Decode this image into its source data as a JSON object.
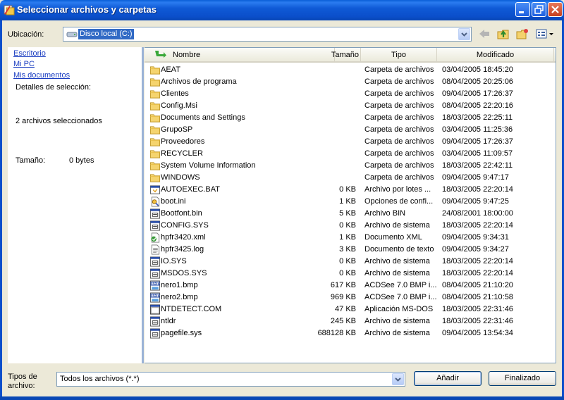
{
  "window": {
    "title": "Seleccionar archivos y carpetas"
  },
  "location": {
    "label": "Ubicación:",
    "value": "Disco local (C:)"
  },
  "left_panel": {
    "links": [
      "Escritorio",
      "Mi PC",
      "Mis documentos"
    ],
    "details_label": "Detalles de selección:",
    "selected_count": "2 archivos seleccionados",
    "size_label": "Tamaño:",
    "size_value": "0 bytes"
  },
  "columns": {
    "name": "Nombre",
    "size": "Tamaño",
    "type": "Tipo",
    "modified": "Modificado"
  },
  "files": [
    {
      "name": "AEAT",
      "size": "",
      "type": "Carpeta de archivos",
      "modified": "03/04/2005 18:45:20",
      "icon": "folder-icon"
    },
    {
      "name": "Archivos de programa",
      "size": "",
      "type": "Carpeta de archivos",
      "modified": "08/04/2005 20:25:06",
      "icon": "folder-icon"
    },
    {
      "name": "Clientes",
      "size": "",
      "type": "Carpeta de archivos",
      "modified": "09/04/2005 17:26:37",
      "icon": "folder-icon"
    },
    {
      "name": "Config.Msi",
      "size": "",
      "type": "Carpeta de archivos",
      "modified": "08/04/2005 22:20:16",
      "icon": "folder-icon"
    },
    {
      "name": "Documents and Settings",
      "size": "",
      "type": "Carpeta de archivos",
      "modified": "18/03/2005 22:25:11",
      "icon": "folder-icon"
    },
    {
      "name": "GrupoSP",
      "size": "",
      "type": "Carpeta de archivos",
      "modified": "03/04/2005 11:25:36",
      "icon": "folder-icon"
    },
    {
      "name": "Proveedores",
      "size": "",
      "type": "Carpeta de archivos",
      "modified": "09/04/2005 17:26:37",
      "icon": "folder-icon"
    },
    {
      "name": "RECYCLER",
      "size": "",
      "type": "Carpeta de archivos",
      "modified": "03/04/2005 11:09:57",
      "icon": "folder-icon"
    },
    {
      "name": "System Volume Information",
      "size": "",
      "type": "Carpeta de archivos",
      "modified": "18/03/2005 22:42:11",
      "icon": "folder-icon"
    },
    {
      "name": "WINDOWS",
      "size": "",
      "type": "Carpeta de archivos",
      "modified": "09/04/2005 9:47:17",
      "icon": "folder-icon"
    },
    {
      "name": "AUTOEXEC.BAT",
      "size": "0 KB",
      "type": "Archivo por lotes ...",
      "modified": "18/03/2005 22:20:14",
      "icon": "batch-file-icon"
    },
    {
      "name": "boot.ini",
      "size": "1 KB",
      "type": "Opciones de confi...",
      "modified": "09/04/2005 9:47:25",
      "icon": "settings-file-icon"
    },
    {
      "name": "Bootfont.bin",
      "size": "5 KB",
      "type": "Archivo BIN",
      "modified": "24/08/2001 18:00:00",
      "icon": "system-file-icon"
    },
    {
      "name": "CONFIG.SYS",
      "size": "0 KB",
      "type": "Archivo de sistema",
      "modified": "18/03/2005 22:20:14",
      "icon": "system-file-icon"
    },
    {
      "name": "hpfr3420.xml",
      "size": "1 KB",
      "type": "Documento XML",
      "modified": "09/04/2005 9:34:31",
      "icon": "xml-file-icon"
    },
    {
      "name": "hpfr3425.log",
      "size": "3 KB",
      "type": "Documento de texto",
      "modified": "09/04/2005 9:34:27",
      "icon": "text-file-icon"
    },
    {
      "name": "IO.SYS",
      "size": "0 KB",
      "type": "Archivo de sistema",
      "modified": "18/03/2005 22:20:14",
      "icon": "system-file-icon"
    },
    {
      "name": "MSDOS.SYS",
      "size": "0 KB",
      "type": "Archivo de sistema",
      "modified": "18/03/2005 22:20:14",
      "icon": "system-file-icon"
    },
    {
      "name": "nero1.bmp",
      "size": "617 KB",
      "type": "ACDSee 7.0 BMP i...",
      "modified": "08/04/2005 21:10:20",
      "icon": "bmp-file-icon"
    },
    {
      "name": "nero2.bmp",
      "size": "969 KB",
      "type": "ACDSee 7.0 BMP i...",
      "modified": "08/04/2005 21:10:58",
      "icon": "bmp-file-icon"
    },
    {
      "name": "NTDETECT.COM",
      "size": "47 KB",
      "type": "Aplicación MS-DOS",
      "modified": "18/03/2005 22:31:46",
      "icon": "dos-app-icon"
    },
    {
      "name": "ntldr",
      "size": "245 KB",
      "type": "Archivo de sistema",
      "modified": "18/03/2005 22:31:46",
      "icon": "system-file-icon"
    },
    {
      "name": "pagefile.sys",
      "size": "688128 KB",
      "type": "Archivo de sistema",
      "modified": "09/04/2005 13:54:34",
      "icon": "system-file-icon"
    }
  ],
  "file_type": {
    "label_line1": "Tipos de",
    "label_line2": "archivo:",
    "value": "Todos los archivos (*.*)"
  },
  "buttons": {
    "add": "Añadir",
    "done": "Finalizado"
  },
  "colors": {
    "titlebar": "#0b4fcb",
    "selection": "#316ac5",
    "link": "#1a3dc1"
  }
}
